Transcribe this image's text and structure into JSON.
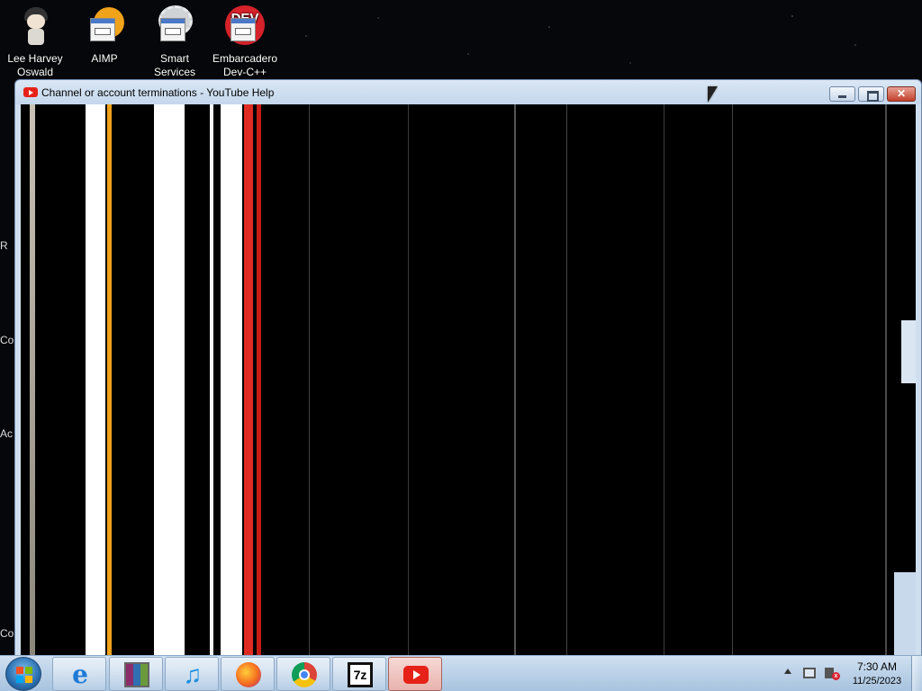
{
  "desktop": {
    "icons": [
      {
        "label_line1": "Lee Harvey",
        "label_line2": "Oswald",
        "icon": "anime-avatar-icon"
      },
      {
        "label_line1": "AIMP",
        "label_line2": "",
        "icon": "aimp-shortcut-icon"
      },
      {
        "label_line1": "Smart",
        "label_line2": "Services",
        "icon": "smart-services-gear-icon"
      },
      {
        "label_line1": "Embarcadero",
        "label_line2": "Dev-C++",
        "icon": "dev-cpp-icon"
      }
    ],
    "edge_fragments": [
      "R",
      "Co",
      "Ac",
      "Co"
    ]
  },
  "window": {
    "title": "Channel or account terminations - YouTube Help",
    "favicon": "youtube-favicon-icon",
    "buttons": {
      "minimize": "minimize-icon",
      "maximize": "maximize-icon",
      "close": "close-icon"
    }
  },
  "taskbar": {
    "start": "windows-start-orb-icon",
    "pinned": [
      {
        "name": "internet-explorer",
        "icon": "internet-explorer-icon"
      },
      {
        "name": "winrar",
        "icon": "winrar-icon"
      },
      {
        "name": "itunes",
        "icon": "music-note-icon"
      },
      {
        "name": "firefox",
        "icon": "firefox-icon"
      },
      {
        "name": "chrome",
        "icon": "chrome-icon"
      },
      {
        "name": "7zip",
        "icon": "7zip-icon",
        "label": "7z"
      },
      {
        "name": "youtube",
        "icon": "youtube-icon",
        "active": true
      }
    ],
    "tray": {
      "time": "7:30 AM",
      "date": "11/25/2023"
    }
  },
  "colors": {
    "youtube_red": "#e62117",
    "aimp_orange": "#f0a21b",
    "titlebar": "#cfdff0",
    "taskbar": "#b9d0e8"
  }
}
